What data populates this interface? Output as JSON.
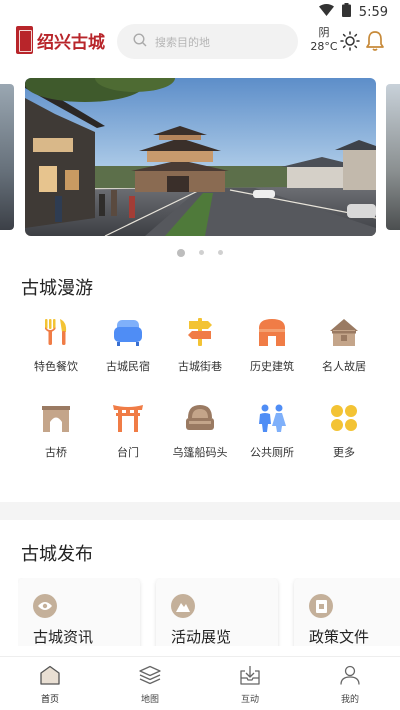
{
  "status_bar": {
    "time": "5:59"
  },
  "header": {
    "logo_text": "绍兴古城",
    "search_placeholder": "搜索目的地",
    "weather": {
      "condition": "阴",
      "temperature": "28°C"
    }
  },
  "banner": {
    "slide_count": 3,
    "active_index": 0
  },
  "tour": {
    "title": "古城漫游",
    "items": [
      {
        "label": "特色餐饮",
        "icon": "fork-knife-icon"
      },
      {
        "label": "古城民宿",
        "icon": "sofa-icon"
      },
      {
        "label": "古城街巷",
        "icon": "signpost-icon"
      },
      {
        "label": "历史建筑",
        "icon": "building-icon"
      },
      {
        "label": "名人故居",
        "icon": "house-icon"
      },
      {
        "label": "古桥",
        "icon": "bridge-icon"
      },
      {
        "label": "台门",
        "icon": "gate-icon"
      },
      {
        "label": "乌篷船码头",
        "icon": "boat-icon"
      },
      {
        "label": "公共厕所",
        "icon": "restroom-icon"
      },
      {
        "label": "更多",
        "icon": "more-icon"
      }
    ]
  },
  "publish": {
    "title": "古城发布",
    "cards": [
      {
        "label": "古城资讯",
        "icon": "eye-icon"
      },
      {
        "label": "活动展览",
        "icon": "mountain-icon"
      },
      {
        "label": "政策文件",
        "icon": "document-icon"
      }
    ]
  },
  "nav": {
    "items": [
      {
        "label": "首页",
        "icon": "home-icon"
      },
      {
        "label": "地图",
        "icon": "map-layers-icon"
      },
      {
        "label": "互动",
        "icon": "interact-icon"
      },
      {
        "label": "我的",
        "icon": "profile-icon"
      }
    ]
  },
  "colors": {
    "brand_red": "#b8252a",
    "icon_yellow": "#f3c334",
    "icon_blue": "#4f8df5",
    "icon_orange": "#f07c46",
    "icon_brown": "#9a7a62",
    "card_icon": "#c4b09a"
  }
}
